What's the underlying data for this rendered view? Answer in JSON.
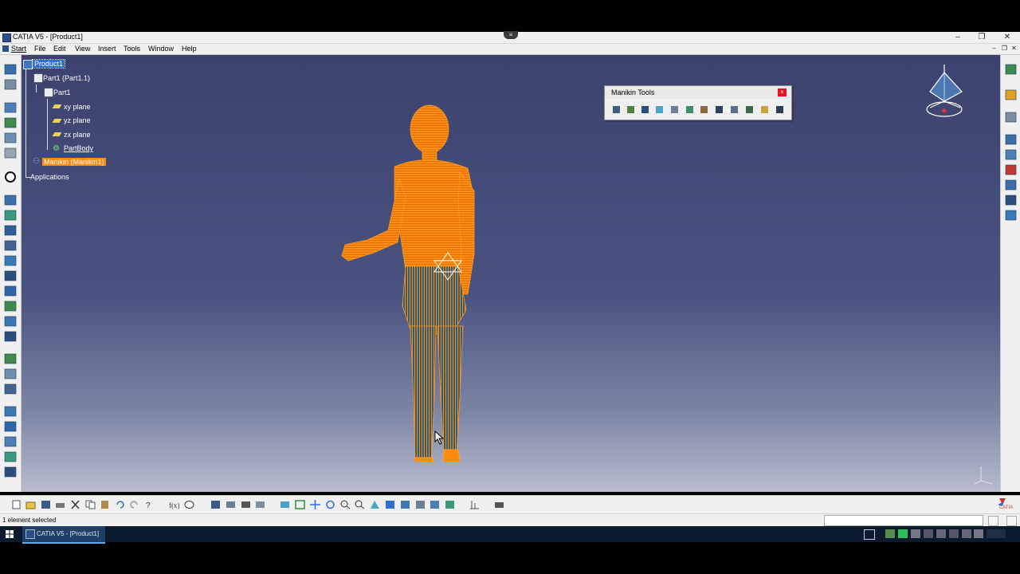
{
  "window": {
    "title": "CATIA V5 - [Product1]"
  },
  "menubar": {
    "items": [
      "Start",
      "File",
      "Edit",
      "View",
      "Insert",
      "Tools",
      "Window",
      "Help"
    ]
  },
  "tree": {
    "nodes": [
      {
        "label": "Product1",
        "state": "selected"
      },
      {
        "label": "Part1 (Part1.1)",
        "state": "normal"
      },
      {
        "label": "Part1",
        "state": "normal"
      },
      {
        "label": "xy plane",
        "state": "normal"
      },
      {
        "label": "yz plane",
        "state": "normal"
      },
      {
        "label": "zx plane",
        "state": "normal"
      },
      {
        "label": "PartBody",
        "state": "underlined"
      },
      {
        "label": "Manikin (Manikin1)",
        "state": "highlighted"
      },
      {
        "label": "Applications",
        "state": "normal"
      }
    ]
  },
  "manikin_tools": {
    "title": "Manikin Tools",
    "close": "×",
    "icon_count": 12
  },
  "statusbar": {
    "text": "1 element selected",
    "command_value": ""
  },
  "taskbar": {
    "app_label": "CATIA V5 - [Product1]"
  },
  "brand": {
    "logo_text": "CATIA"
  },
  "colors": {
    "manikin": "#ff8a10",
    "background_top": "#3c426e",
    "background_bottom": "#b8bccc",
    "selection": "#2f6fd1"
  }
}
